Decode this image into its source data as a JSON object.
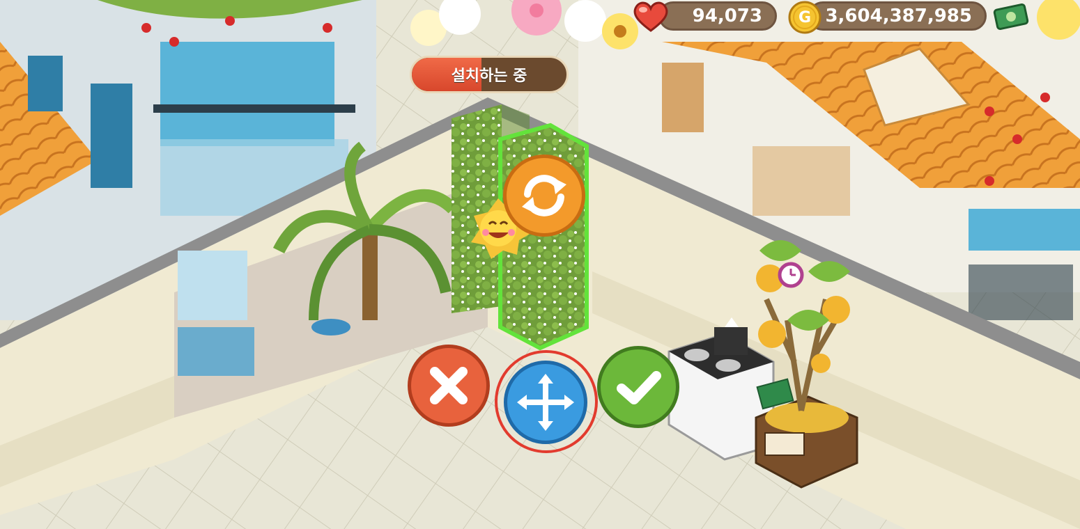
{
  "hud": {
    "hearts": "94,073",
    "coins": "3,604,387,985",
    "heart_icon": "heart-icon",
    "coin_icon": "coin-icon",
    "coin_symbol": "G",
    "cash_icon": "cash-icon"
  },
  "status": {
    "label": "설치하는 중",
    "progress": 0.45
  },
  "actions": {
    "rotate": "rotate-icon",
    "cancel": "close-icon",
    "move": "move-icon",
    "confirm": "check-icon"
  },
  "colors": {
    "cancel": "#e8623d",
    "move": "#3a9be0",
    "confirm": "#6cb83a",
    "rotate": "#f39a2b",
    "highlight_ring": "#e23b2e"
  }
}
